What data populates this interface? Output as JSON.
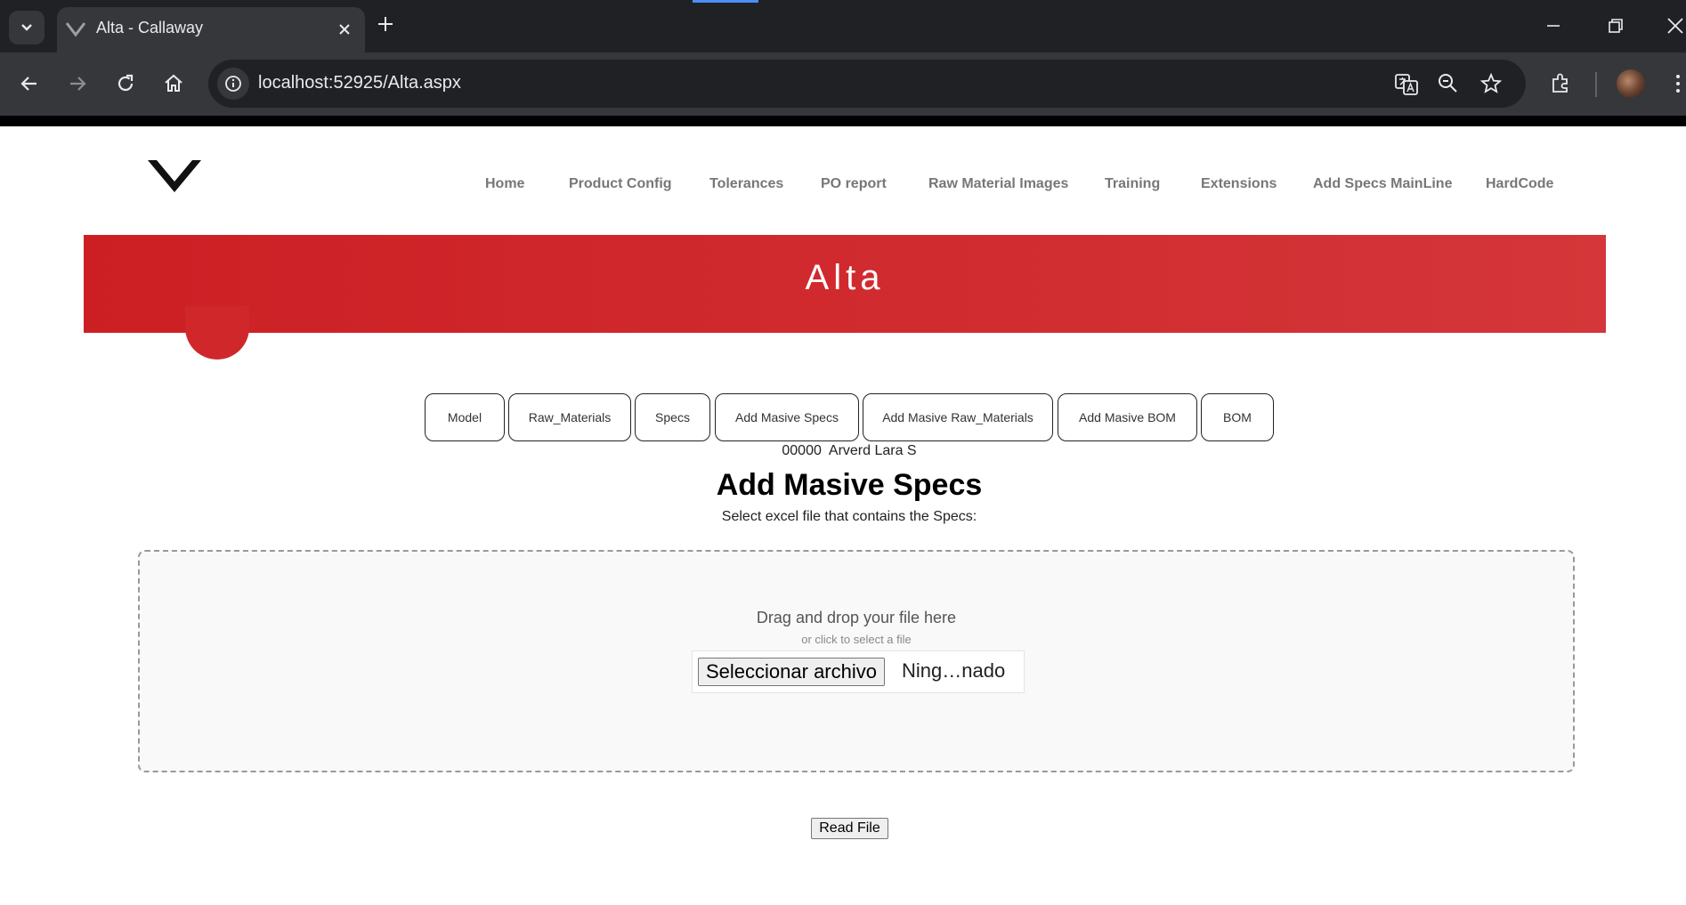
{
  "browser": {
    "tab_title": "Alta - Callaway",
    "url": "localhost:52925/Alta.aspx",
    "accent_color": "#4c8df6"
  },
  "nav": {
    "links": [
      "Home",
      "Product Config",
      "Tolerances",
      "PO report",
      "Raw Material Images",
      "Training",
      "Extensions",
      "Add Specs MainLine",
      "HardCode"
    ]
  },
  "banner": {
    "title": "Alta",
    "color": "#d0272b"
  },
  "tabs": [
    "Model",
    "Raw_Materials",
    "Specs",
    "Add Masive Specs",
    "Add Masive Raw_Materials",
    "Add Masive BOM",
    "BOM"
  ],
  "user": {
    "id": "00000",
    "name": "Arverd Lara S"
  },
  "section": {
    "title": "Add Masive Specs",
    "subtitle": "Select excel file that contains the Specs:"
  },
  "dropzone": {
    "text": "Drag and drop your file here",
    "subtext": "or click to select a file",
    "file_button": "Seleccionar archivo",
    "file_status": "Ning…nado"
  },
  "actions": {
    "read_file": "Read File"
  }
}
